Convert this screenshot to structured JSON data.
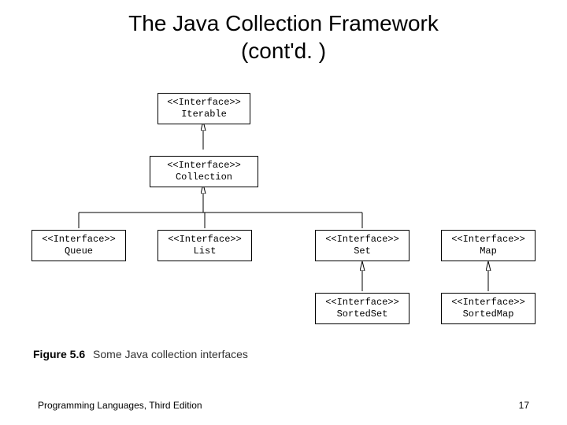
{
  "title_line1": "The Java Collection Framework",
  "title_line2": "(cont'd. )",
  "boxes": {
    "iterable": {
      "stereo": "<<Interface>>",
      "name": "Iterable"
    },
    "collection": {
      "stereo": "<<Interface>>",
      "name": "Collection"
    },
    "queue": {
      "stereo": "<<Interface>>",
      "name": "Queue"
    },
    "list": {
      "stereo": "<<Interface>>",
      "name": "List"
    },
    "set": {
      "stereo": "<<Interface>>",
      "name": "Set"
    },
    "map": {
      "stereo": "<<Interface>>",
      "name": "Map"
    },
    "sortedset": {
      "stereo": "<<Interface>>",
      "name": "SortedSet"
    },
    "sortedmap": {
      "stereo": "<<Interface>>",
      "name": "SortedMap"
    }
  },
  "caption": {
    "label": "Figure 5.6",
    "text": "Some Java collection interfaces"
  },
  "footer": {
    "left": "Programming Languages, Third Edition",
    "page": "17"
  }
}
